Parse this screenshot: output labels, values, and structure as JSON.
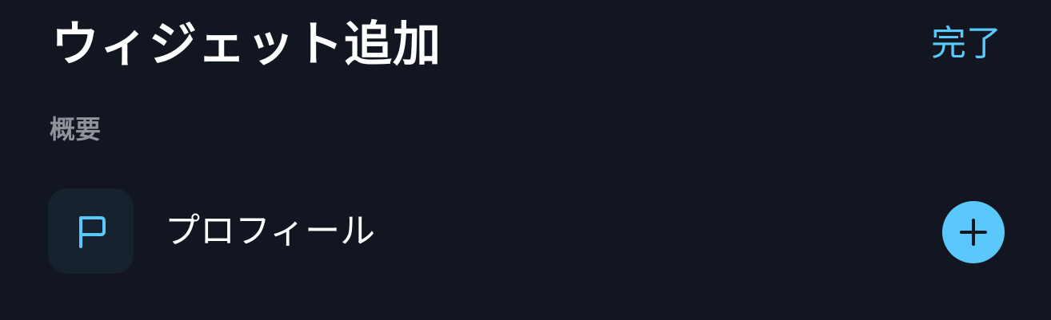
{
  "header": {
    "title": "ウィジェット追加",
    "done_label": "完了"
  },
  "sections": [
    {
      "label": "概要",
      "items": [
        {
          "label": "プロフィール",
          "icon": "flag-icon",
          "action_icon": "plus-icon"
        }
      ]
    }
  ],
  "colors": {
    "background": "#111620",
    "accent": "#5ac8fa",
    "tile": "#16222e",
    "section_label": "#8e939c"
  }
}
